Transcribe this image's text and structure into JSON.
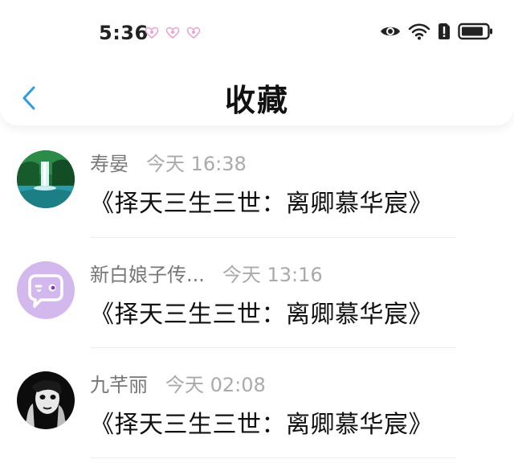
{
  "status": {
    "time": "5:36"
  },
  "header": {
    "title": "收藏",
    "back_icon": "chevron-left-icon",
    "accent": "#2f9be0"
  },
  "favorites": [
    {
      "name": "寿晏",
      "time": "今天 16:38",
      "message": "《择天三生三世：离卿慕华宸》",
      "avatar": "waterfall-landscape"
    },
    {
      "name": "新白娘子传...",
      "time": "今天 13:16",
      "message": "《择天三生三世：离卿慕华宸》",
      "avatar": "chat-bubble-face-icon"
    },
    {
      "name": "九芊丽",
      "time": "今天 02:08",
      "message": "《择天三生三世：离卿慕华宸》",
      "avatar": "dark-portrait"
    }
  ]
}
